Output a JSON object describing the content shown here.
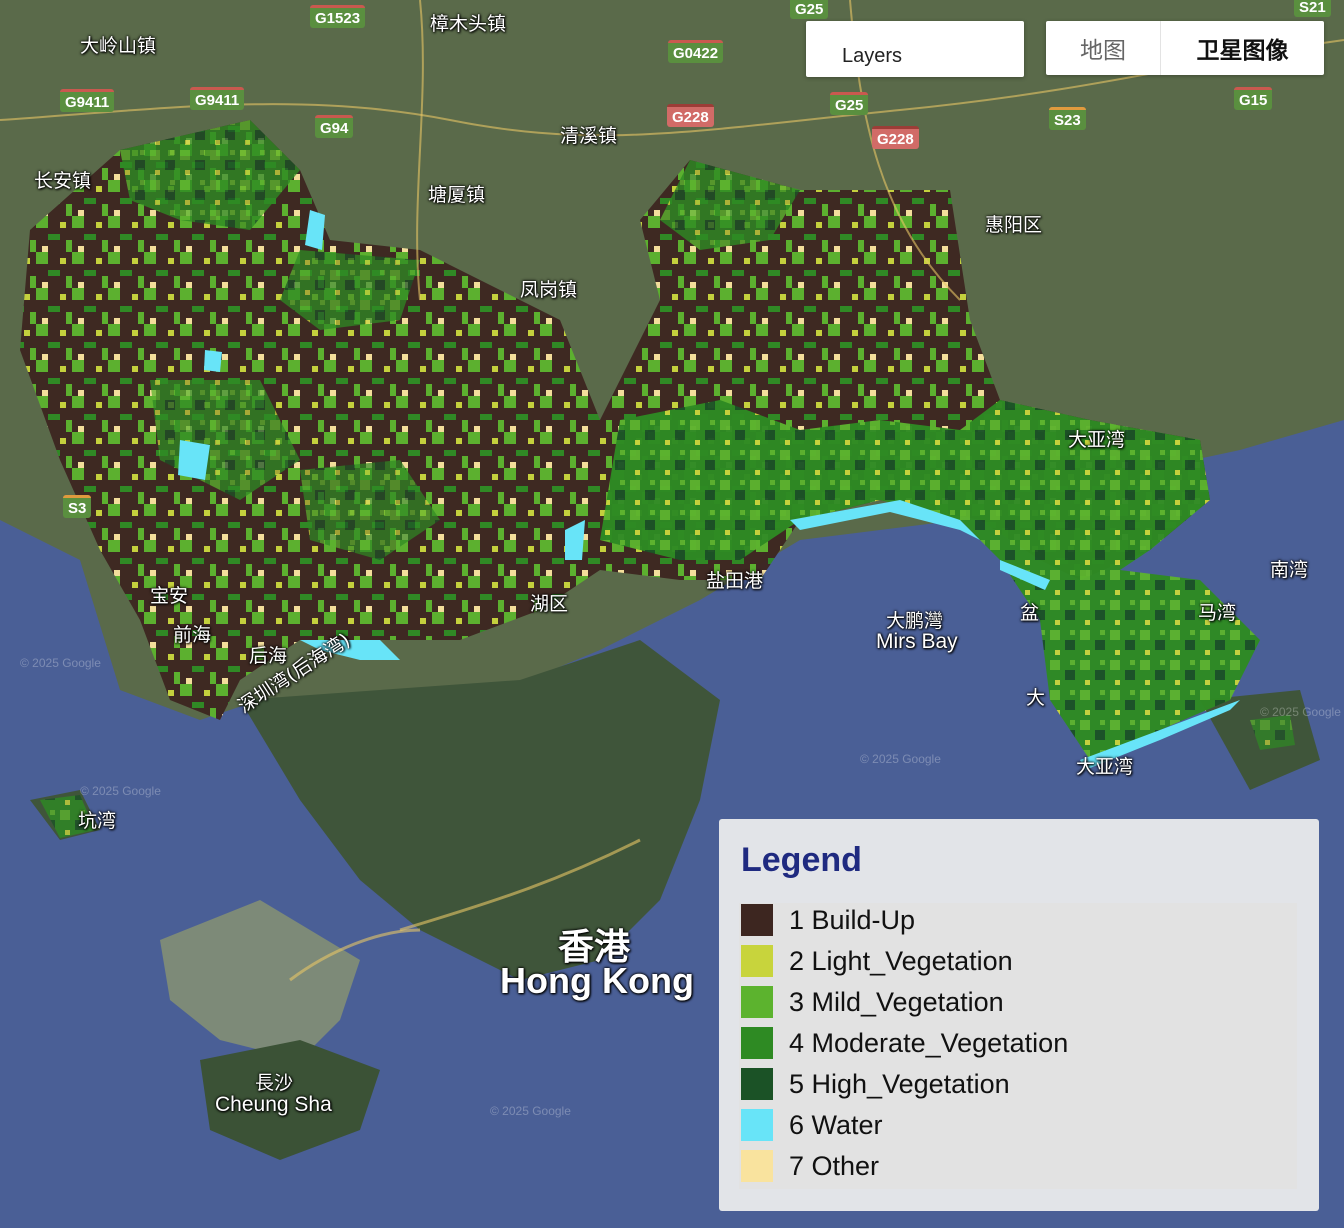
{
  "map": {
    "place_labels": {
      "daling": "大岭山镇",
      "zhangmutou": "樟木头镇",
      "changan": "长安镇",
      "qingxi": "清溪镇",
      "tangxia": "塘厦镇",
      "huiyang": "惠阳区",
      "fenggang": "凤岗镇",
      "dayawan_n": "大亚湾",
      "nanwan": "南湾",
      "yantian": "盐田港",
      "dapeng_cn": "大鹏灣",
      "dapeng_en": "Mirs Bay",
      "mawan": "马湾",
      "yan": "盆",
      "da": "大",
      "dayawan_s": "大亚湾",
      "baoan": "宝安",
      "qianhai": "前海",
      "houhai": "后海",
      "shenzhenwan": "深圳湾(后海湾)",
      "huqu": "湖区",
      "kengwan": "坑湾",
      "hk_cn": "香港",
      "hk_en": "Hong Kong",
      "cheungsha_cn": "長沙",
      "cheungsha_en": "Cheung Sha"
    },
    "road_shields": {
      "g25a": "G25",
      "g1523": "G1523",
      "g0422": "G0422",
      "s21": "S21",
      "g9411a": "G9411",
      "g9411b": "G9411",
      "g94": "G94",
      "g228a": "G228",
      "g25b": "G25",
      "g228b": "G228",
      "s23": "S23",
      "g15": "G15",
      "s3": "S3"
    },
    "watermark": "© 2025 Google"
  },
  "controls": {
    "layers_label": "Layers",
    "map_type": {
      "map_label": "地图",
      "satellite_label": "卫星图像",
      "selected": "satellite"
    }
  },
  "legend": {
    "title": "Legend",
    "items": [
      {
        "label": "1 Build-Up",
        "color": "#3d2620"
      },
      {
        "label": "2 Light_Vegetation",
        "color": "#c8d43c"
      },
      {
        "label": "3 Mild_Vegetation",
        "color": "#5cb32e"
      },
      {
        "label": "4 Moderate_Vegetation",
        "color": "#2e8a23"
      },
      {
        "label": "5 High_Vegetation",
        "color": "#1b5226"
      },
      {
        "label": "6 Water",
        "color": "#68e4f8"
      },
      {
        "label": "7 Other",
        "color": "#f9e39e"
      }
    ]
  }
}
